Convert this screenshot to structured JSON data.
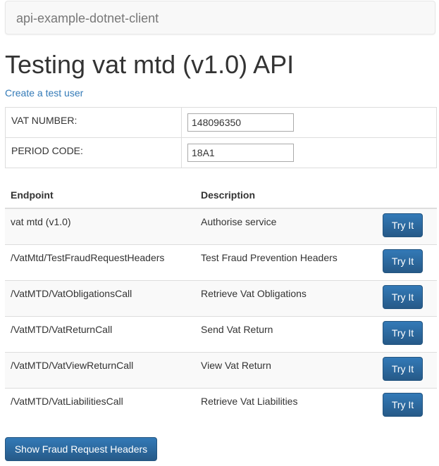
{
  "navbar": {
    "brand": "api-example-dotnet-client"
  },
  "page": {
    "title": "Testing vat mtd (v1.0) API",
    "create_link": "Create a test user"
  },
  "form": {
    "vat_number": {
      "label": "VAT NUMBER:",
      "value": "148096350"
    },
    "period_code": {
      "label": "PERIOD CODE:",
      "value": "18A1"
    }
  },
  "endpoints": {
    "headers": {
      "endpoint": "Endpoint",
      "description": "Description"
    },
    "rows": [
      {
        "endpoint": "vat mtd (v1.0)",
        "description": "Authorise service",
        "button": "Try It"
      },
      {
        "endpoint": "/VatMtd/TestFraudRequestHeaders",
        "description": "Test Fraud Prevention Headers",
        "button": "Try It"
      },
      {
        "endpoint": "/VatMTD/VatObligationsCall",
        "description": "Retrieve Vat Obligations",
        "button": "Try It"
      },
      {
        "endpoint": "/VatMTD/VatReturnCall",
        "description": "Send Vat Return",
        "button": "Try It"
      },
      {
        "endpoint": "/VatMTD/VatViewReturnCall",
        "description": "View Vat Return",
        "button": "Try It"
      },
      {
        "endpoint": "/VatMTD/VatLiabilitiesCall",
        "description": "Retrieve Vat Liabilities",
        "button": "Try It"
      }
    ]
  },
  "footer": {
    "show_headers_button": "Show Fraud Request Headers"
  },
  "colors": {
    "link": "#337ab7",
    "button": "#337ab7",
    "brand_text": "#777777"
  }
}
